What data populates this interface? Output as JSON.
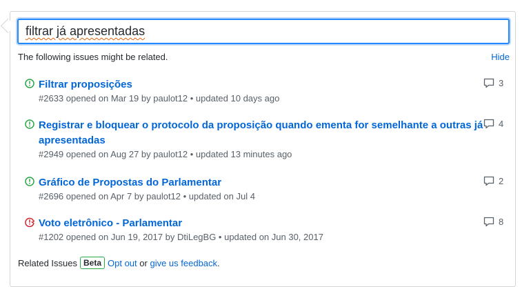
{
  "search": {
    "value": "filtrar já apresentadas"
  },
  "notice": {
    "text": "The following issues might be related.",
    "hide_label": "Hide"
  },
  "issues": [
    {
      "state": "open",
      "icon": "issue-opened-icon",
      "title": "Filtrar proposições",
      "meta": "#2633 opened on Mar 19 by paulot12 • updated 10 days ago",
      "comments": "3"
    },
    {
      "state": "open",
      "icon": "issue-opened-icon",
      "title": "Registrar e bloquear o protocolo da proposição quando ementa for semelhante a outras já apresentadas",
      "meta": "#2949 opened on Aug 27 by paulot12 • updated 13 minutes ago",
      "comments": "4"
    },
    {
      "state": "open",
      "icon": "issue-opened-icon",
      "title": "Gráfico de Propostas do Parlamentar",
      "meta": "#2696 opened on Apr 7 by paulot12 • updated on Jul 4",
      "comments": "2"
    },
    {
      "state": "closed",
      "icon": "issue-closed-icon",
      "title": "Voto eletrônico - Parlamentar",
      "meta": "#1202 opened on Jun 19, 2017 by DtiLegBG • updated on Jun 30, 2017",
      "comments": "8"
    }
  ],
  "footer": {
    "label": "Related Issues",
    "badge": "Beta",
    "opt_out": "Opt out",
    "or": "or",
    "feedback": "give us feedback",
    "period": "."
  },
  "colors": {
    "open": "#28a745",
    "closed": "#cb2431",
    "link": "#0366d6"
  }
}
